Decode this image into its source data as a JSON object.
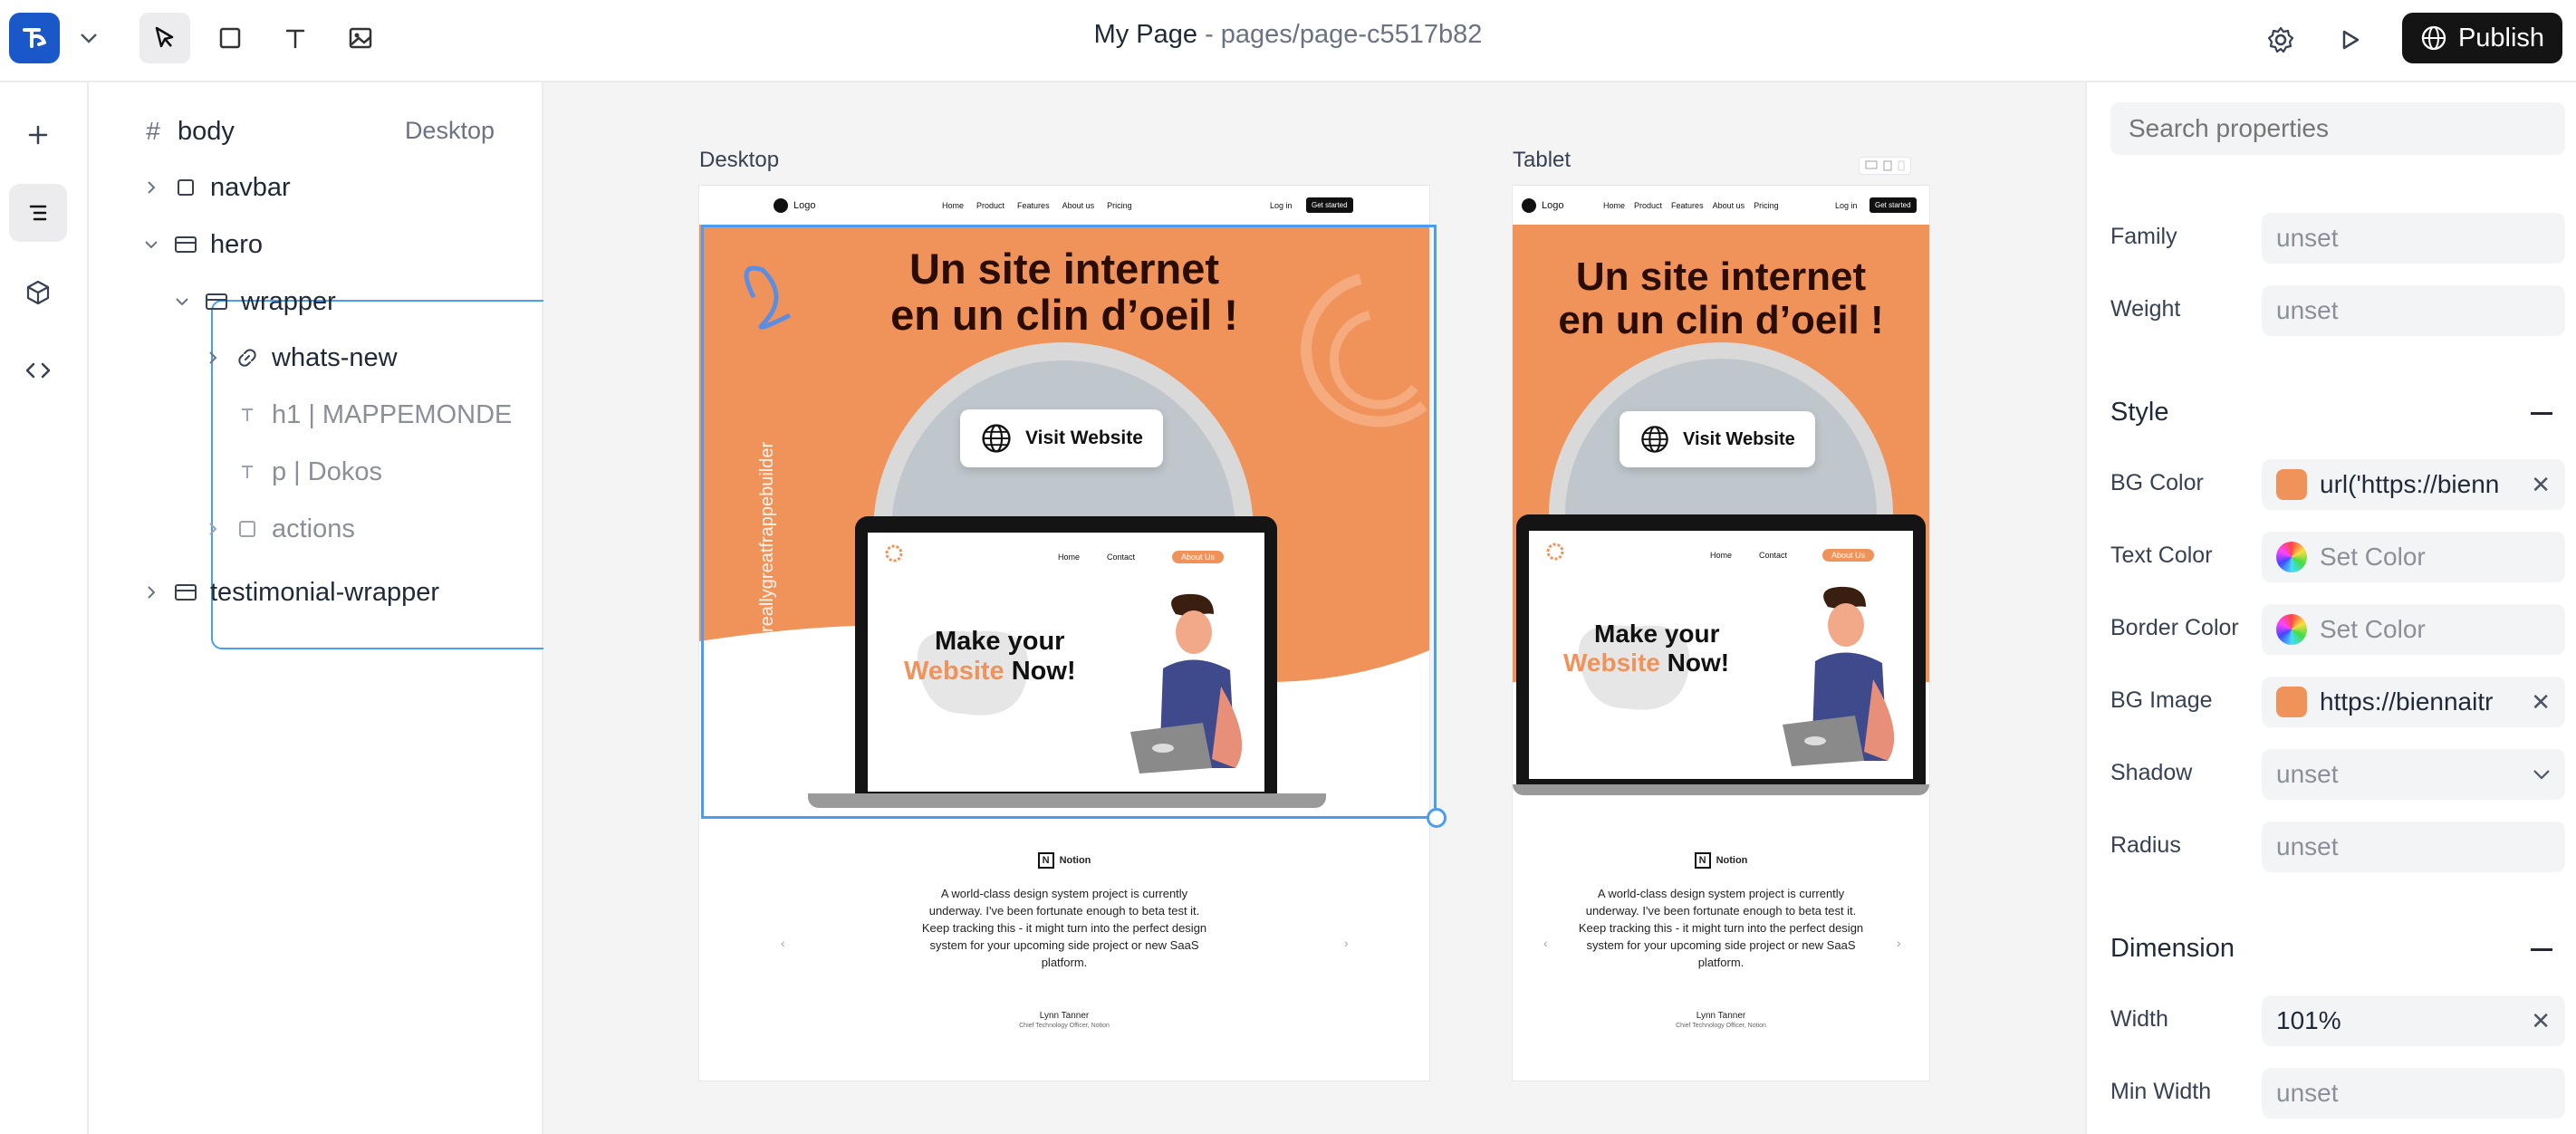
{
  "topbar": {
    "title": "My Page",
    "separator": " - ",
    "path": "pages/page-c5517b82",
    "publish_label": "Publish",
    "tools": [
      "select-tool",
      "frame-tool",
      "text-tool",
      "image-tool"
    ]
  },
  "rail": {
    "items": [
      "add",
      "layers",
      "components",
      "code"
    ]
  },
  "layers": {
    "root_label": "body",
    "root_mode": "Desktop",
    "items": [
      {
        "label": "navbar"
      },
      {
        "label": "hero"
      },
      {
        "label": "wrapper"
      },
      {
        "label": "whats-new"
      },
      {
        "label": "h1 | MAPPEMONDE"
      },
      {
        "label": "p | Dokos"
      },
      {
        "label": "actions"
      },
      {
        "label": "testimonial-wrapper"
      }
    ]
  },
  "canvas": {
    "frames": [
      {
        "label": "Desktop"
      },
      {
        "label": "Tablet"
      }
    ],
    "site": {
      "nav_logo": "Logo",
      "nav_links": [
        "Home",
        "Product",
        "Features",
        "About us",
        "Pricing"
      ],
      "login": "Log in",
      "cta": "Get started",
      "hero_line1": "Un site internet",
      "hero_line2": "en un clin d’oeil !",
      "vertical_text": "reallygreatfrappebuilder",
      "visit": "Visit Website",
      "mini_links": [
        "Home",
        "Contact"
      ],
      "mini_about": "About Us",
      "make_line1": "Make your",
      "make_orange": "Website",
      "make_rest": " Now!",
      "notion": "Notion",
      "quote": "A world-class design system project is currently underway. I've been fortunate enough to beta test it. Keep tracking this - it might turn into the perfect design system for your upcoming side project or new SaaS platform.",
      "name": "Lynn Tanner",
      "role": "Chief Technology Officer, Notion"
    }
  },
  "props": {
    "search_placeholder": "Search properties",
    "typography": {
      "family_label": "Family",
      "family_value": "unset",
      "weight_label": "Weight",
      "weight_value": "unset"
    },
    "style": {
      "section": "Style",
      "bg_color_label": "BG Color",
      "bg_color_value": "url('https://bienn",
      "text_color_label": "Text Color",
      "text_color_value": "Set Color",
      "border_color_label": "Border Color",
      "border_color_value": "Set Color",
      "bg_image_label": "BG Image",
      "bg_image_value": "https://biennaitr",
      "shadow_label": "Shadow",
      "shadow_value": "unset",
      "radius_label": "Radius",
      "radius_value": "unset"
    },
    "dimension": {
      "section": "Dimension",
      "width_label": "Width",
      "width_value": "101%",
      "min_width_label": "Min Width",
      "min_width_value": "unset"
    }
  },
  "colors": {
    "accent": "#1a57c9",
    "selection": "#4a9ef2",
    "hero_orange": "#f0935a",
    "publish_bg": "#141414"
  }
}
